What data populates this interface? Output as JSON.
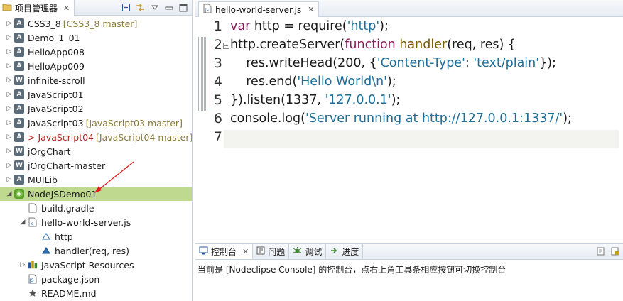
{
  "explorer": {
    "title": "项目管理器",
    "close": "✕",
    "tree": [
      {
        "label": "CSS3_8",
        "deco": "[CSS3_8 master]",
        "icon": "A",
        "depth": 0,
        "twisty": "▷"
      },
      {
        "label": "Demo_1_01",
        "deco": "",
        "icon": "A",
        "depth": 0,
        "twisty": "▷"
      },
      {
        "label": "HelloApp008",
        "deco": "",
        "icon": "A",
        "depth": 0,
        "twisty": "▷"
      },
      {
        "label": "HelloApp009",
        "deco": "",
        "icon": "A",
        "depth": 0,
        "twisty": "▷"
      },
      {
        "label": "infinite-scroll",
        "deco": "",
        "icon": "W",
        "depth": 0,
        "twisty": "▷"
      },
      {
        "label": "JavaScript01",
        "deco": "",
        "icon": "A",
        "depth": 0,
        "twisty": "▷"
      },
      {
        "label": "JavaScript02",
        "deco": "",
        "icon": "A",
        "depth": 0,
        "twisty": "▷"
      },
      {
        "label": "JavaScript03",
        "deco": "[JavaScript03 master]",
        "icon": "A",
        "depth": 0,
        "twisty": "▷"
      },
      {
        "label": "> JavaScript04",
        "deco": "[JavaScript04 master]",
        "icon": "A",
        "depth": 0,
        "twisty": "▷",
        "dirty": true
      },
      {
        "label": "jOrgChart",
        "deco": "",
        "icon": "W",
        "depth": 0,
        "twisty": "▷"
      },
      {
        "label": "jOrgChart-master",
        "deco": "",
        "icon": "W",
        "depth": 0,
        "twisty": "▷"
      },
      {
        "label": "MUILib",
        "deco": "",
        "icon": "A",
        "depth": 0,
        "twisty": "▷"
      },
      {
        "label": "NodeJSDemo01",
        "deco": "",
        "icon": "N",
        "depth": 0,
        "twisty": "◢",
        "selected": true
      },
      {
        "label": "build.gradle",
        "deco": "",
        "icon": "file",
        "depth": 1,
        "twisty": ""
      },
      {
        "label": "hello-world-server.js",
        "deco": "",
        "icon": "jsfile",
        "depth": 1,
        "twisty": "◢"
      },
      {
        "label": "http",
        "deco": "",
        "icon": "var",
        "depth": 2,
        "twisty": ""
      },
      {
        "label": "handler(req, res)",
        "deco": "",
        "icon": "func",
        "depth": 2,
        "twisty": ""
      },
      {
        "label": "JavaScript Resources",
        "deco": "",
        "icon": "lib",
        "depth": 1,
        "twisty": "▷"
      },
      {
        "label": "package.json",
        "deco": "",
        "icon": "json",
        "depth": 1,
        "twisty": ""
      },
      {
        "label": "README.md",
        "deco": "",
        "icon": "star",
        "depth": 1,
        "twisty": ""
      }
    ]
  },
  "editor": {
    "tab_label": "hello-world-server.js",
    "close": "✕",
    "line_numbers": [
      "1",
      "2",
      "3",
      "4",
      "5",
      "6",
      "7"
    ],
    "lines": [
      [
        {
          "t": "var",
          "c": "kw"
        },
        {
          "t": " http = require(",
          "c": ""
        },
        {
          "t": "'http'",
          "c": "str"
        },
        {
          "t": ");",
          "c": ""
        }
      ],
      [
        {
          "t": "http.createServer(",
          "c": ""
        },
        {
          "t": "function",
          "c": "kw"
        },
        {
          "t": " ",
          "c": ""
        },
        {
          "t": "handler",
          "c": "fn"
        },
        {
          "t": "(req, res) {",
          "c": ""
        }
      ],
      [
        {
          "t": "    res.writeHead(200, {",
          "c": ""
        },
        {
          "t": "'Content-Type'",
          "c": "str"
        },
        {
          "t": ": ",
          "c": ""
        },
        {
          "t": "'text/plain'",
          "c": "str"
        },
        {
          "t": "});",
          "c": ""
        }
      ],
      [
        {
          "t": "    res.end(",
          "c": ""
        },
        {
          "t": "'Hello World\\n'",
          "c": "str"
        },
        {
          "t": ");",
          "c": ""
        }
      ],
      [
        {
          "t": "}).listen(1337, ",
          "c": ""
        },
        {
          "t": "'127.0.0.1'",
          "c": "str"
        },
        {
          "t": ");",
          "c": ""
        }
      ],
      [
        {
          "t": "console.log(",
          "c": ""
        },
        {
          "t": "'Server running at http://127.0.0.1:1337/'",
          "c": "str"
        },
        {
          "t": ");",
          "c": ""
        }
      ],
      []
    ]
  },
  "console": {
    "tabs": [
      {
        "label": "控制台",
        "close": "✕",
        "icon": "console-icon"
      },
      {
        "label": "问题",
        "icon": "problems-icon"
      },
      {
        "label": "调试",
        "icon": "debug-icon"
      },
      {
        "label": "进度",
        "icon": "progress-icon"
      }
    ],
    "message": "当前是 [Nodeclipse Console] 的控制台，点右上角工具条相应按钮可切换控制台"
  },
  "colors": {
    "selection": "#bfd98f",
    "keyword": "#8b1c5a",
    "string": "#1d6f9a",
    "annotation_arrow": "#e02020"
  }
}
